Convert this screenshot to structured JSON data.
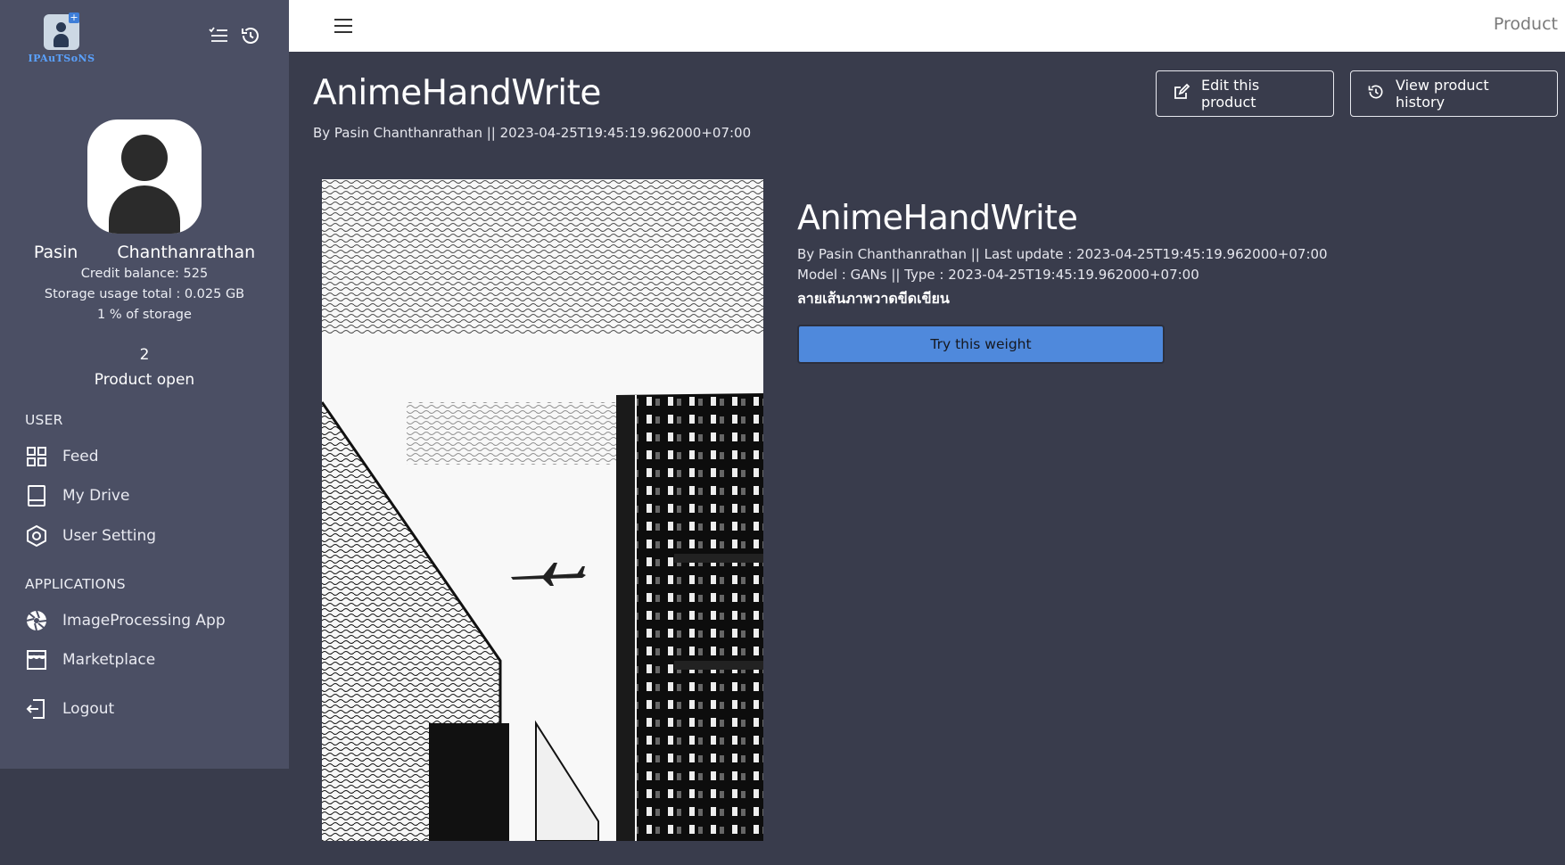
{
  "logo": {
    "text": "IPAuTSoNS"
  },
  "sidebar": {
    "icons": {
      "list": "list-check-icon",
      "history": "history-icon"
    },
    "user": {
      "first_name": "Pasin",
      "last_name": "Chanthanrathan",
      "credit": "Credit balance: 525",
      "storage_total": "Storage usage total : 0.025 GB",
      "storage_percent": "1 % of storage",
      "product_count": "2",
      "product_label": "Product open"
    },
    "user_section": "USER",
    "user_items": [
      {
        "label": "Feed",
        "icon": "grid-icon"
      },
      {
        "label": "My Drive",
        "icon": "drive-icon"
      },
      {
        "label": "User Setting",
        "icon": "hexagon-setting-icon"
      }
    ],
    "apps_section": "APPLICATIONS",
    "app_items": [
      {
        "label": "ImageProcessing App",
        "icon": "aperture-icon"
      },
      {
        "label": "Marketplace",
        "icon": "store-icon"
      }
    ],
    "logout": {
      "label": "Logout",
      "icon": "logout-icon"
    }
  },
  "topbar": {
    "title": "Product"
  },
  "page": {
    "title": "AnimeHandWrite",
    "subtitle": "By Pasin Chanthanrathan || 2023-04-25T19:45:19.962000+07:00",
    "edit_button": "Edit this product",
    "history_button": "View product history"
  },
  "detail": {
    "title": "AnimeHandWrite",
    "line1": "By Pasin Chanthanrathan || Last update : 2023-04-25T19:45:19.962000+07:00",
    "line2": "Model : GANs || Type : 2023-04-25T19:45:19.962000+07:00",
    "description": "ลายเส้นภาพวาดขีดเขียน",
    "try_button": "Try this weight"
  },
  "colors": {
    "sidebar_bg": "#4b4f64",
    "main_bg": "#393c4c",
    "accent": "#4f89dc"
  }
}
